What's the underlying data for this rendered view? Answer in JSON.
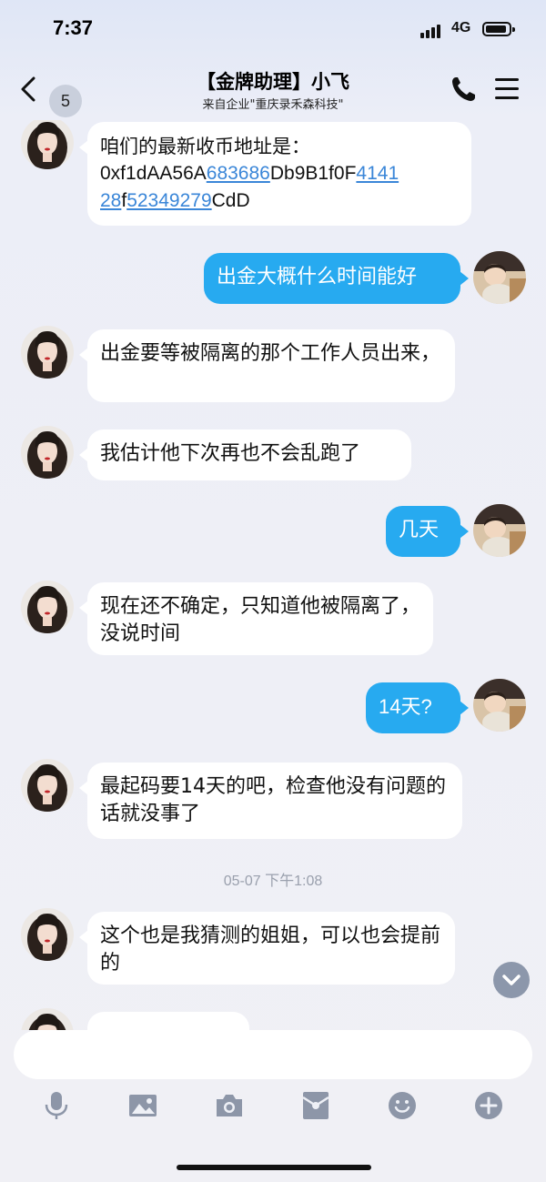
{
  "status_bar": {
    "time": "7:37",
    "network": "4G"
  },
  "nav": {
    "back_count": "5",
    "title": "【金牌助理】小飞",
    "subtitle": "来自企业\"重庆录禾森科技\""
  },
  "messages": [
    {
      "side": "in",
      "parts": [
        "咱们的最新收币地址是：",
        "0xf1dAA56A",
        "683686",
        "Db9B1f0F",
        "4141",
        "28",
        "f",
        "52349279",
        "CdD"
      ]
    },
    {
      "side": "out",
      "text": "出金大概什么时间能好"
    },
    {
      "side": "in",
      "text": "出金要等被隔离的那个工作人员出来，"
    },
    {
      "side": "in",
      "text": "我估计他下次再也不会乱跑了"
    },
    {
      "side": "out",
      "text": "几天"
    },
    {
      "side": "in",
      "text": "现在还不确定，只知道他被隔离了，没说时间"
    },
    {
      "side": "out",
      "text": "14天?"
    },
    {
      "side": "in",
      "text": "最起码要14天的吧，检查他没有问题的话就没事了"
    },
    {
      "side": "in",
      "text": "这个也是我猜测的姐姐，可以也会提前的"
    }
  ],
  "timestamp": "05-07 下午1:08",
  "input": {
    "placeholder": ""
  },
  "toolbar": [
    "microphone-icon",
    "image-icon",
    "camera-icon",
    "red-packet-icon",
    "emoji-icon",
    "plus-icon"
  ],
  "colors": {
    "accent": "#27aaf0",
    "link": "#3a86d8",
    "incoming_bubble": "#ffffff",
    "background": "#eceef7"
  }
}
